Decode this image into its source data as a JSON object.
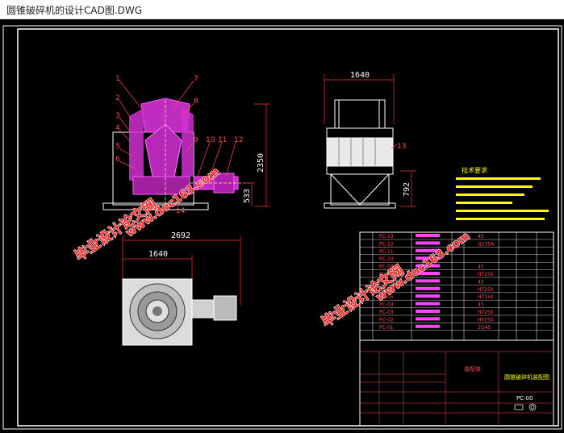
{
  "window": {
    "title": "圆锥破碎机的设计CAD图.DWG"
  },
  "drawing": {
    "dimensions": {
      "top_width": "1640",
      "plan_total": "2692",
      "plan_width": "1640",
      "height_total": "2350",
      "height_base": "533",
      "side_height": "792"
    },
    "part_numbers": [
      "1",
      "2",
      "3",
      "4",
      "5",
      "6",
      "7",
      "8",
      "9",
      "10",
      "11",
      "12",
      "13",
      "14"
    ],
    "tech_requirements_title": "技术要求",
    "title_block": {
      "drawing_name": "圆锥破碎机装配图",
      "drawing_no": "PC-00",
      "name_label": "装配体"
    },
    "bom_codes": [
      "PC-13",
      "PC-12",
      "PC-11",
      "PC-10",
      "PC-09",
      "PC-08",
      "PC-07",
      "PC-06",
      "PC-05",
      "PC-04",
      "PC-03",
      "PC-02",
      "PC-01"
    ],
    "bom_materials": [
      "45",
      "Q235A",
      "",
      "",
      "45",
      "HT250",
      "45",
      "HT250",
      "HT150",
      "45",
      "HT250",
      "HT250",
      "ZG45"
    ],
    "watermarks": {
      "text1": "毕业设计论文网",
      "text2": "www.doc163.com"
    }
  }
}
